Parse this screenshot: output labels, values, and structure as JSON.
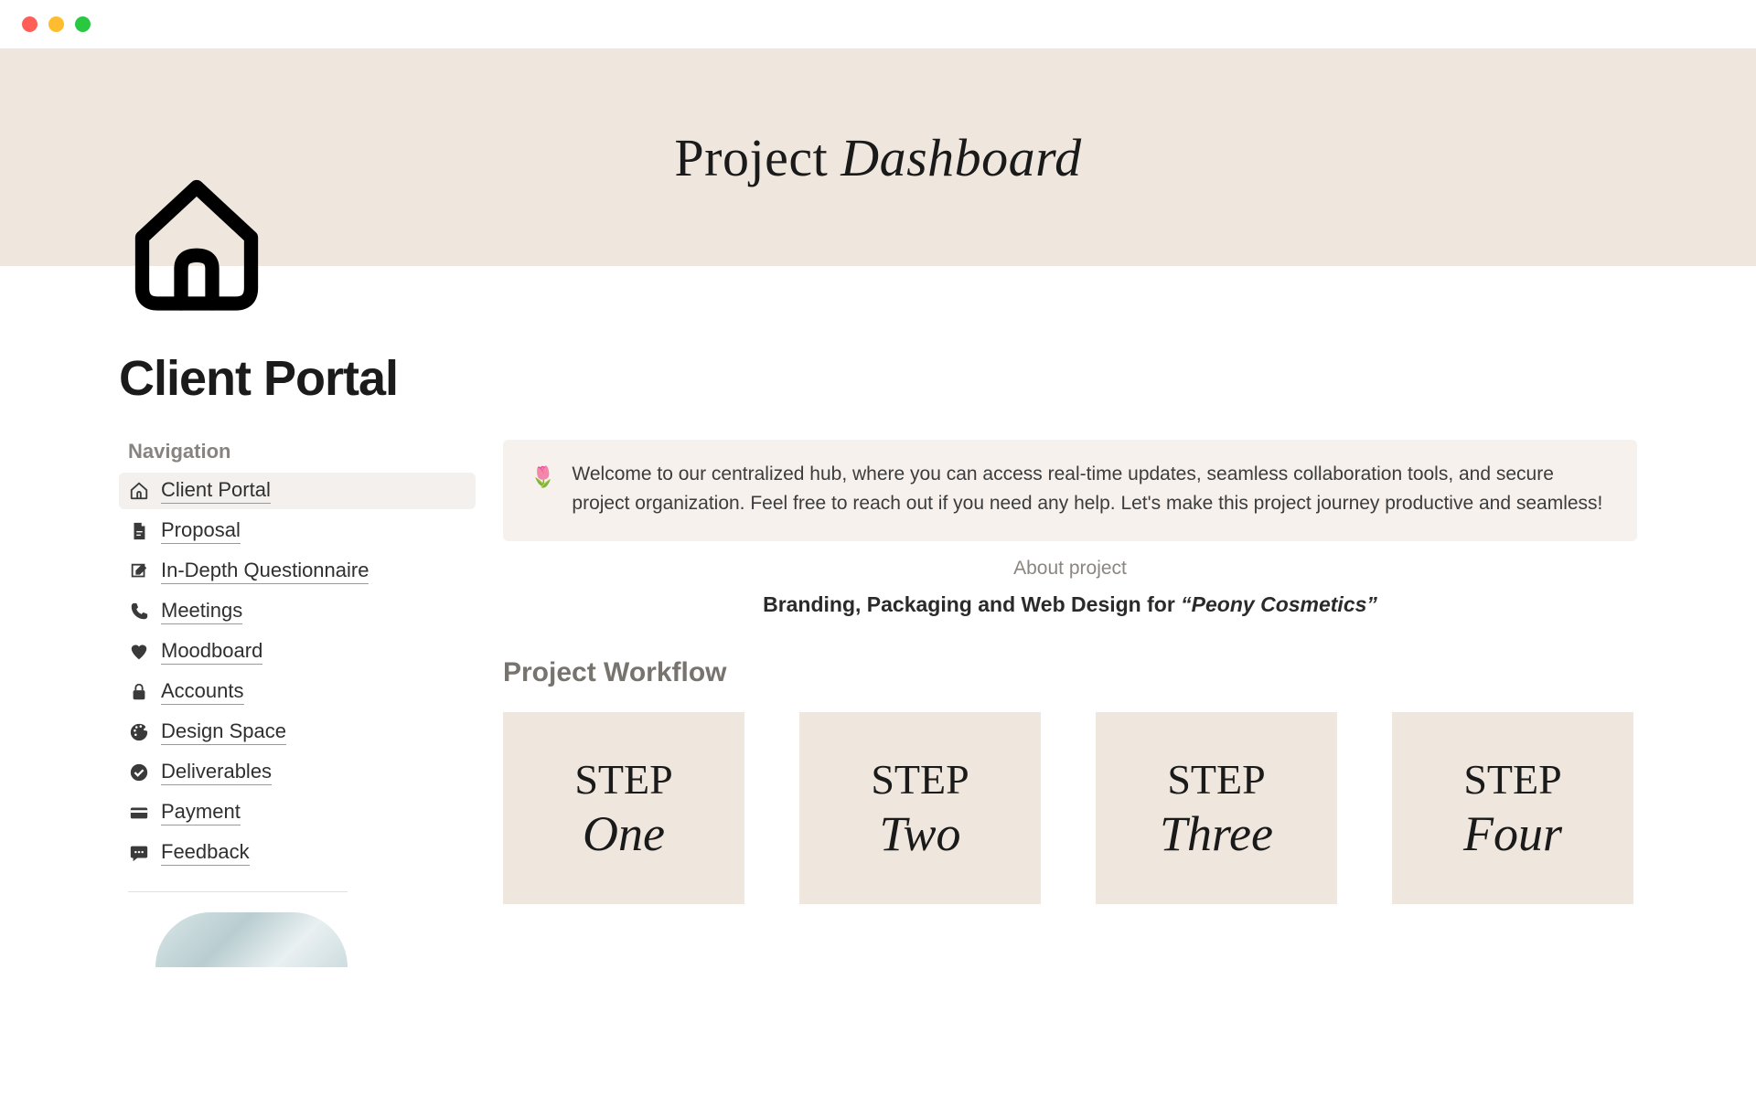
{
  "banner": {
    "title_regular": "Project",
    "title_italic": "Dashboard"
  },
  "page": {
    "title": "Client Portal"
  },
  "nav": {
    "heading": "Navigation",
    "items": [
      {
        "label": "Client Portal",
        "icon": "home-icon",
        "active": true
      },
      {
        "label": "Proposal",
        "icon": "proposal-icon",
        "active": false
      },
      {
        "label": "In-Depth Questionnaire",
        "icon": "questionnaire-icon",
        "active": false
      },
      {
        "label": "Meetings",
        "icon": "phone-icon",
        "active": false
      },
      {
        "label": "Moodboard",
        "icon": "heart-icon",
        "active": false
      },
      {
        "label": "Accounts",
        "icon": "lock-icon",
        "active": false
      },
      {
        "label": "Design Space",
        "icon": "palette-icon",
        "active": false
      },
      {
        "label": "Deliverables",
        "icon": "check-circle-icon",
        "active": false
      },
      {
        "label": "Payment",
        "icon": "payment-icon",
        "active": false
      },
      {
        "label": "Feedback",
        "icon": "feedback-icon",
        "active": false
      }
    ]
  },
  "welcome": {
    "icon": "flower-icon",
    "text": "Welcome to our centralized hub, where you can access real-time updates, seamless collaboration tools, and secure project organization. Feel free to reach out if you need any help. Let's make this project journey productive and seamless!"
  },
  "about": {
    "label": "About project",
    "prefix": "Branding, Packaging and Web Design for ",
    "client": "“Peony Cosmetics”"
  },
  "workflow": {
    "heading": "Project Workflow",
    "step_label": "STEP",
    "steps": [
      "One",
      "Two",
      "Three",
      "Four"
    ]
  }
}
